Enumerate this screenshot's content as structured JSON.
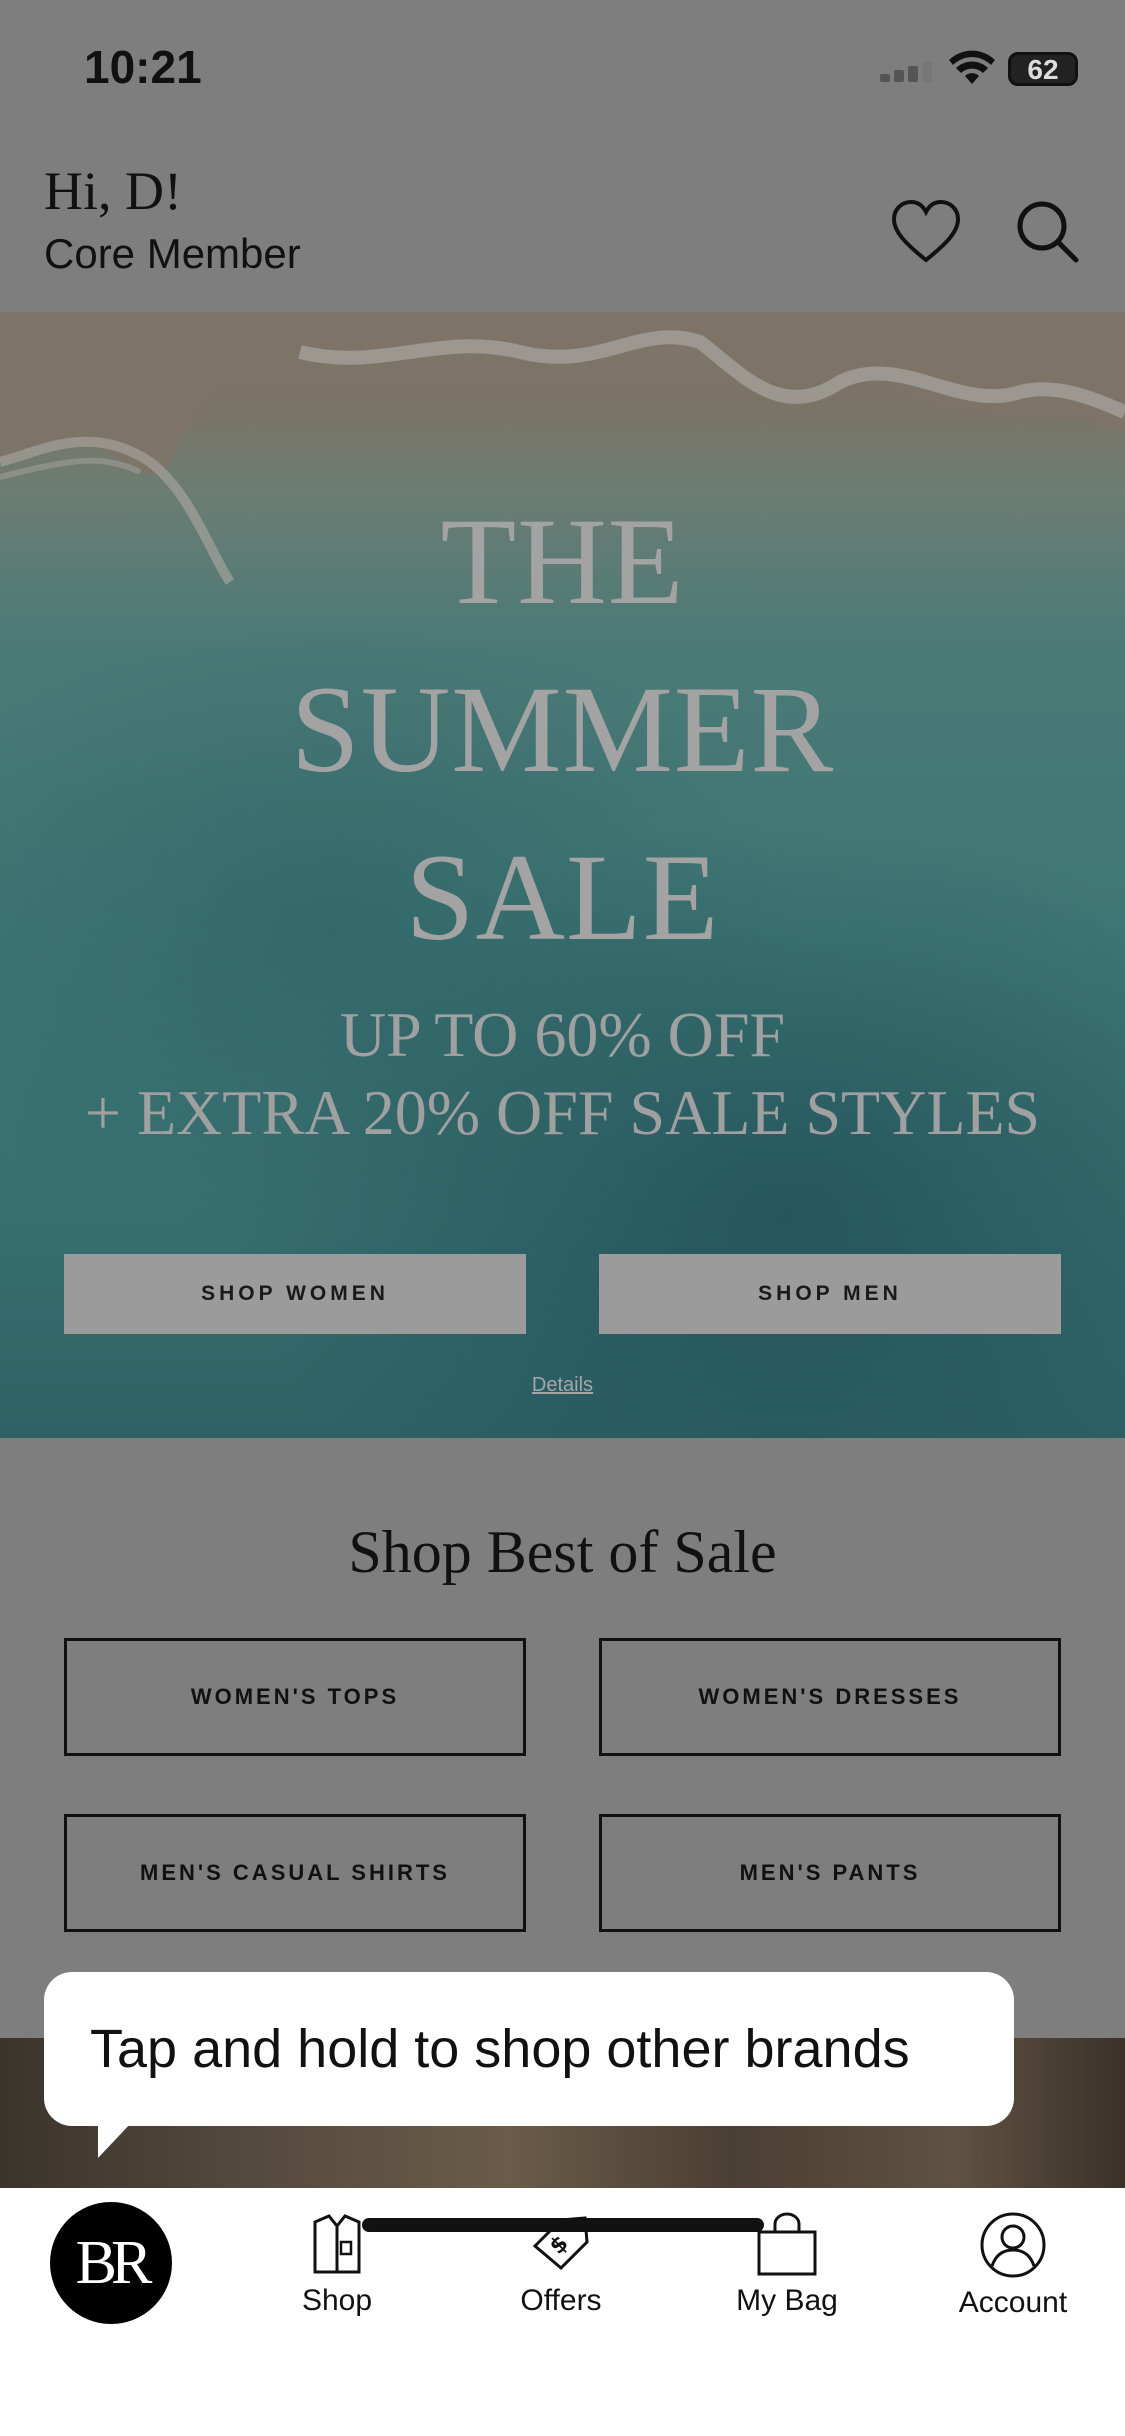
{
  "status_bar": {
    "time": "10:21",
    "battery": "62"
  },
  "header": {
    "greeting": "Hi, D!",
    "member_tier": "Core Member"
  },
  "hero": {
    "title_lines": [
      "THE",
      "SUMMER",
      "SALE"
    ],
    "offer_line_1": "UP TO 60% OFF",
    "offer_line_2": "+ EXTRA 20% OFF SALE STYLES",
    "shop_women": "SHOP WOMEN",
    "shop_men": "SHOP MEN",
    "details": "Details"
  },
  "best_of_sale": {
    "title": "Shop Best of Sale",
    "categories": [
      "WOMEN'S TOPS",
      "WOMEN'S DRESSES",
      "MEN'S CASUAL SHIRTS",
      "MEN'S PANTS"
    ]
  },
  "tooltip": {
    "text": "Tap and hold to shop other brands"
  },
  "tabbar": {
    "brand_logo": "BR",
    "tabs": [
      {
        "label": "Shop",
        "icon": "shirt-icon"
      },
      {
        "label": "Offers",
        "icon": "price-tag-icon"
      },
      {
        "label": "My Bag",
        "icon": "shopping-bag-icon"
      },
      {
        "label": "Account",
        "icon": "account-icon"
      }
    ]
  },
  "colors": {
    "overlay_gray": "#7e7e7e",
    "tooltip_bg": "#ffffff",
    "logo_bg": "#000000"
  }
}
